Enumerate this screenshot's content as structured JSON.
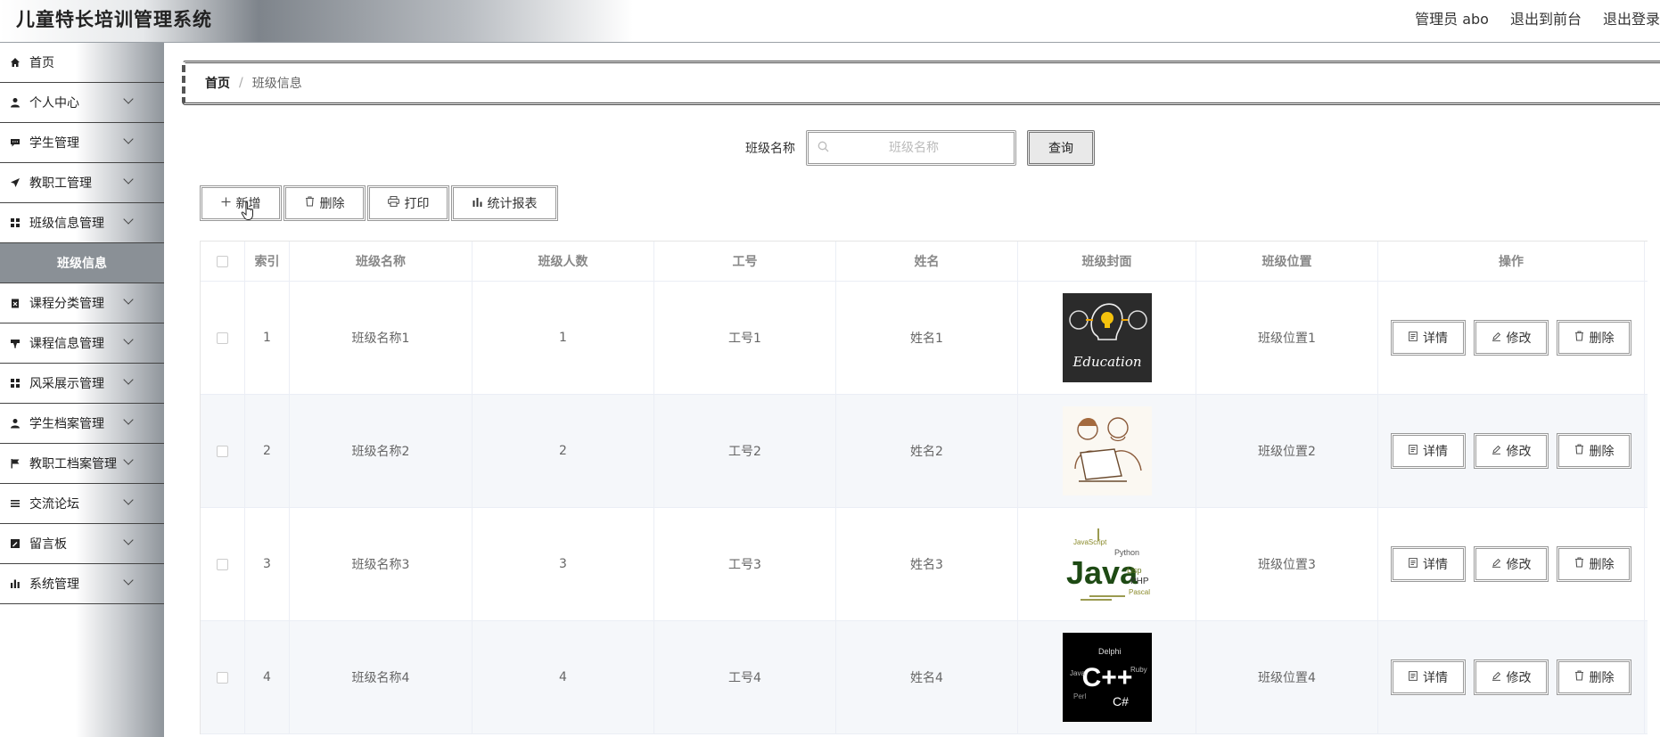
{
  "header": {
    "title": "儿童特长培训管理系统",
    "nav": [
      "管理员 abo",
      "退出到前台",
      "退出登录"
    ]
  },
  "sidebar": {
    "items": [
      {
        "label": "首页",
        "icon": "home-icon",
        "has_children": false
      },
      {
        "label": "个人中心",
        "icon": "user-icon",
        "has_children": true
      },
      {
        "label": "学生管理",
        "icon": "chat-icon",
        "has_children": true
      },
      {
        "label": "教职工管理",
        "icon": "send-icon",
        "has_children": true
      },
      {
        "label": "班级信息管理",
        "icon": "grid-icon",
        "has_children": true
      },
      {
        "label": "课程分类管理",
        "icon": "clipboard-icon",
        "has_children": true
      },
      {
        "label": "课程信息管理",
        "icon": "cup-icon",
        "has_children": true
      },
      {
        "label": "风采展示管理",
        "icon": "grid-icon",
        "has_children": true
      },
      {
        "label": "学生档案管理",
        "icon": "user-icon",
        "has_children": true
      },
      {
        "label": "教职工档案管理",
        "icon": "flag-icon",
        "has_children": true
      },
      {
        "label": "交流论坛",
        "icon": "list-icon",
        "has_children": true
      },
      {
        "label": "留言板",
        "icon": "edit-icon",
        "has_children": true
      },
      {
        "label": "系统管理",
        "icon": "chart-icon",
        "has_children": true
      }
    ],
    "active_sub": "班级信息"
  },
  "breadcrumb": {
    "home": "首页",
    "sep": "/",
    "current": "班级信息"
  },
  "search": {
    "label": "班级名称",
    "placeholder": "班级名称",
    "value": "",
    "button": "查询"
  },
  "actions": {
    "add": "新增",
    "delete": "删除",
    "print": "打印",
    "report": "统计报表"
  },
  "table": {
    "columns": [
      "",
      "索引",
      "班级名称",
      "班级人数",
      "工号",
      "姓名",
      "班级封面",
      "班级位置",
      "操作"
    ],
    "rows": [
      {
        "index": "1",
        "name": "班级名称1",
        "count": "1",
        "staff_no": "工号1",
        "staff_name": "姓名1",
        "cover": "education-chalkboard",
        "location": "班级位置1"
      },
      {
        "index": "2",
        "name": "班级名称2",
        "count": "2",
        "staff_no": "工号2",
        "staff_name": "姓名2",
        "cover": "people-at-laptop-sketch",
        "location": "班级位置2"
      },
      {
        "index": "3",
        "name": "班级名称3",
        "count": "3",
        "staff_no": "工号3",
        "staff_name": "姓名3",
        "cover": "java-word-cloud",
        "location": "班级位置3"
      },
      {
        "index": "4",
        "name": "班级名称4",
        "count": "4",
        "staff_no": "工号4",
        "staff_name": "姓名4",
        "cover": "cpp-word-cloud",
        "location": "班级位置4"
      }
    ],
    "row_ops": {
      "detail": "详情",
      "edit": "修改",
      "delete": "删除"
    }
  },
  "cover_text": {
    "education": "Education",
    "java": "Java",
    "java_words": [
      "JavaScript",
      "Python",
      "Lisp",
      "PHP",
      "Pascal"
    ],
    "cpp": "C++",
    "cpp_words": [
      "Delphi",
      "C#",
      "Java",
      "Ruby",
      "Perl"
    ]
  }
}
